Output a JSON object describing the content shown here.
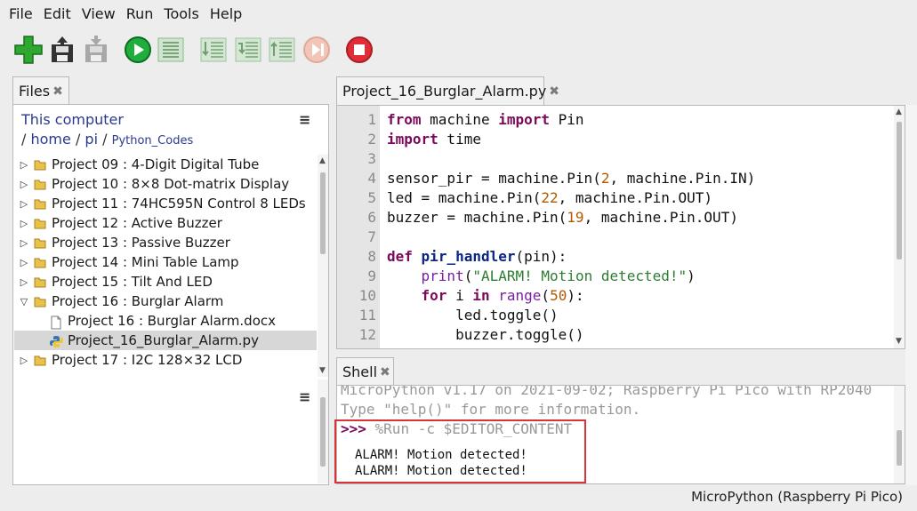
{
  "menu": [
    "File",
    "Edit",
    "View",
    "Run",
    "Tools",
    "Help"
  ],
  "toolbar": {
    "buttons": [
      "new-file",
      "load-file",
      "save-file",
      "run",
      "debug",
      "step-over",
      "step-into",
      "step-out",
      "resume",
      "stop"
    ]
  },
  "files_tab": {
    "title": "Files",
    "close": "✖",
    "location": "This computer",
    "crumb_sep1": "/",
    "crumb_home": "home",
    "crumb_sep2": "/",
    "crumb_pi": "pi",
    "crumb_sep3": "/",
    "crumb_codes": "Python_Codes",
    "menu_icon": "≡",
    "items": [
      {
        "label": "Project 09 : 4-Digit Digital Tube",
        "type": "folder",
        "expanded": false
      },
      {
        "label": "Project 10 : 8×8 Dot-matrix Display",
        "type": "folder",
        "expanded": false
      },
      {
        "label": "Project 11 : 74HC595N Control 8 LEDs",
        "type": "folder",
        "expanded": false
      },
      {
        "label": "Project 12 : Active Buzzer",
        "type": "folder",
        "expanded": false
      },
      {
        "label": "Project 13 : Passive Buzzer",
        "type": "folder",
        "expanded": false
      },
      {
        "label": "Project 14 : Mini Table Lamp",
        "type": "folder",
        "expanded": false
      },
      {
        "label": "Project 15 : Tilt And LED",
        "type": "folder",
        "expanded": false
      },
      {
        "label": "Project 16 : Burglar Alarm",
        "type": "folder",
        "expanded": true
      },
      {
        "label": "Project 16 : Burglar Alarm.docx",
        "type": "doc",
        "expanded": false
      },
      {
        "label": "Project_16_Burglar_Alarm.py",
        "type": "python",
        "expanded": false,
        "selected": true
      },
      {
        "label": "Project 17 :  I2C 128×32 LCD",
        "type": "folder",
        "expanded": false
      }
    ]
  },
  "editor": {
    "tab_title": "Project_16_Burglar_Alarm.py",
    "close": "✖",
    "line_numbers": [
      "1",
      "2",
      "3",
      "4",
      "5",
      "6",
      "7",
      "8",
      "9",
      "10",
      "11",
      "12"
    ]
  },
  "shell": {
    "tab_title": "Shell",
    "close": "✖",
    "banner": "MicroPython v1.17 on 2021-09-02; Raspberry Pi Pico with RP2040",
    "help": "Type \"help()\" for more information.",
    "prompt": ">>>",
    "command": " %Run -c $EDITOR_CONTENT",
    "output": [
      "ALARM! Motion detected!",
      "ALARM! Motion detected!"
    ]
  },
  "status": {
    "interpreter": "MicroPython (Raspberry Pi Pico)"
  },
  "colors": {
    "accent_red": "#d9343a",
    "keyword": "#7a0a5a",
    "link": "#2b3990"
  }
}
